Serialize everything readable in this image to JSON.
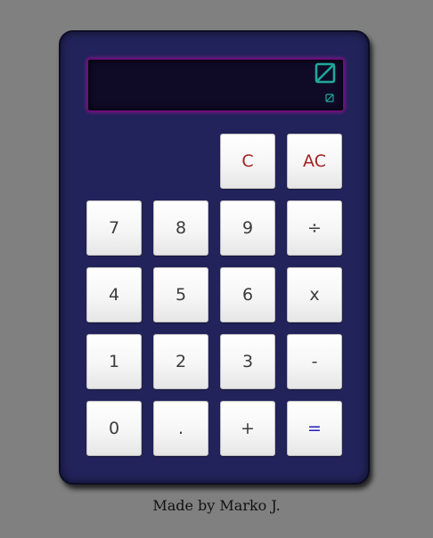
{
  "display": {
    "main_icon": "empty-set-icon",
    "sub_icon": "empty-set-icon",
    "icon_color": "#1fa89a"
  },
  "keys": {
    "clear": "C",
    "all_clear": "AC",
    "seven": "7",
    "eight": "8",
    "nine": "9",
    "divide": "÷",
    "four": "4",
    "five": "5",
    "six": "6",
    "multiply": "x",
    "one": "1",
    "two": "2",
    "three": "3",
    "minus": "-",
    "zero": "0",
    "decimal": ".",
    "plus": "+",
    "equals": "="
  },
  "footer": {
    "credit": "Made by Marko J."
  },
  "colors": {
    "page_background": "#808080",
    "body": "#22235a",
    "display_background": "#0f0a26",
    "display_border": "#6a0f78",
    "clear_keys": "#a32222",
    "equals_key": "#1c1cb8"
  }
}
